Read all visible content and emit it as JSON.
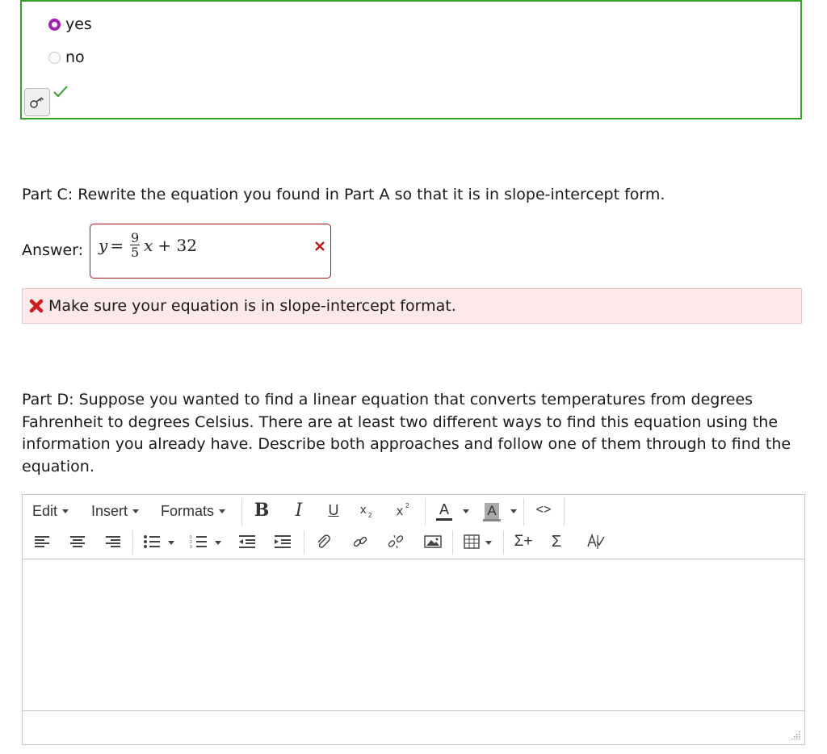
{
  "part_b": {
    "options": [
      {
        "label": "yes",
        "selected": true
      },
      {
        "label": "no",
        "selected": false
      }
    ],
    "key_icon": "key-icon",
    "status": "correct",
    "colors": {
      "correct": "#34a02c",
      "radio": "#a020b8"
    }
  },
  "part_c": {
    "prompt": "Part C: Rewrite the equation you found in Part A so that it is in slope-intercept form.",
    "answer_label": "Answer:",
    "answer": {
      "lhs": "y",
      "eq": "=",
      "numerator": "9",
      "denominator": "5",
      "var": "x",
      "rest": "+ 32"
    },
    "status": "incorrect",
    "error": "Make sure your equation is in slope-intercept format.",
    "colors": {
      "error_border": "#a81818",
      "error_bg": "#fde9e9",
      "error_icon": "#d01c1c"
    }
  },
  "part_d": {
    "prompt": "Part D: Suppose you wanted to find a linear equation that converts temperatures from degrees Fahrenheit to degrees Celsius. There are at least two different ways to find this equation using the information you already have. Describe both approaches and follow one of them through to find the equation."
  },
  "editor": {
    "menus": [
      "Edit",
      "Insert",
      "Formats"
    ],
    "toolbar": {
      "bold": "B",
      "italic": "I",
      "underline": "U",
      "text_color": "A",
      "bg_color": "A",
      "code": "<>",
      "sigma_plus": "Σ+",
      "sigma": "Σ"
    },
    "content": ""
  }
}
